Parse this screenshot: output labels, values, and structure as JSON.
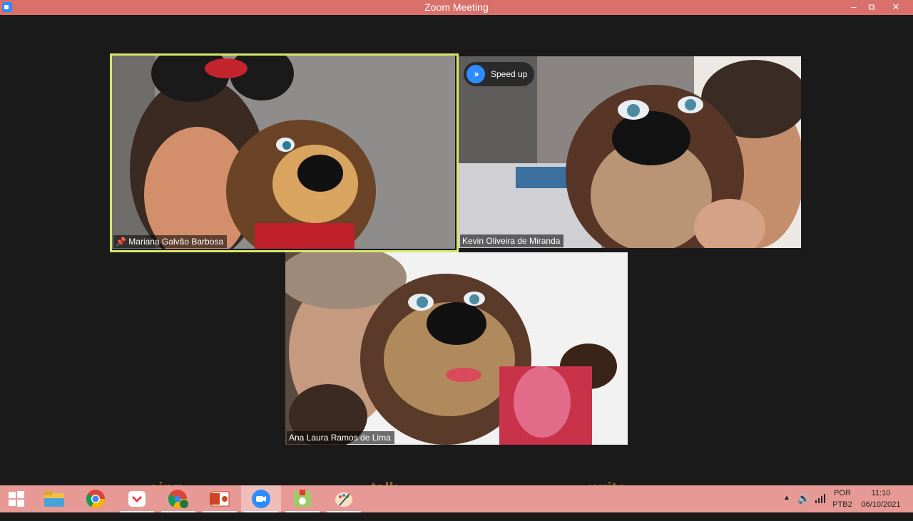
{
  "window": {
    "title": "Zoom Meeting",
    "controls": [
      "minimize",
      "restore",
      "close"
    ]
  },
  "participants": [
    {
      "name": "Mariana Galvão Barbosa",
      "pinned": true,
      "active_speaker": true
    },
    {
      "name": "Kevin Oliveira de Miranda",
      "badge": "Speed up"
    },
    {
      "name": "Ana Laura Ramos de Lima"
    }
  ],
  "taskbar": {
    "ghost_words": [
      "sing",
      "talk",
      "write"
    ],
    "apps": [
      "start",
      "file-explorer",
      "chrome",
      "pocket",
      "chrome-profile",
      "powerpoint",
      "zoom",
      "game",
      "paint"
    ],
    "tray": {
      "lang_top": "POR",
      "lang_bottom": "PTB2",
      "time": "11:10",
      "date": "06/10/2021"
    }
  }
}
